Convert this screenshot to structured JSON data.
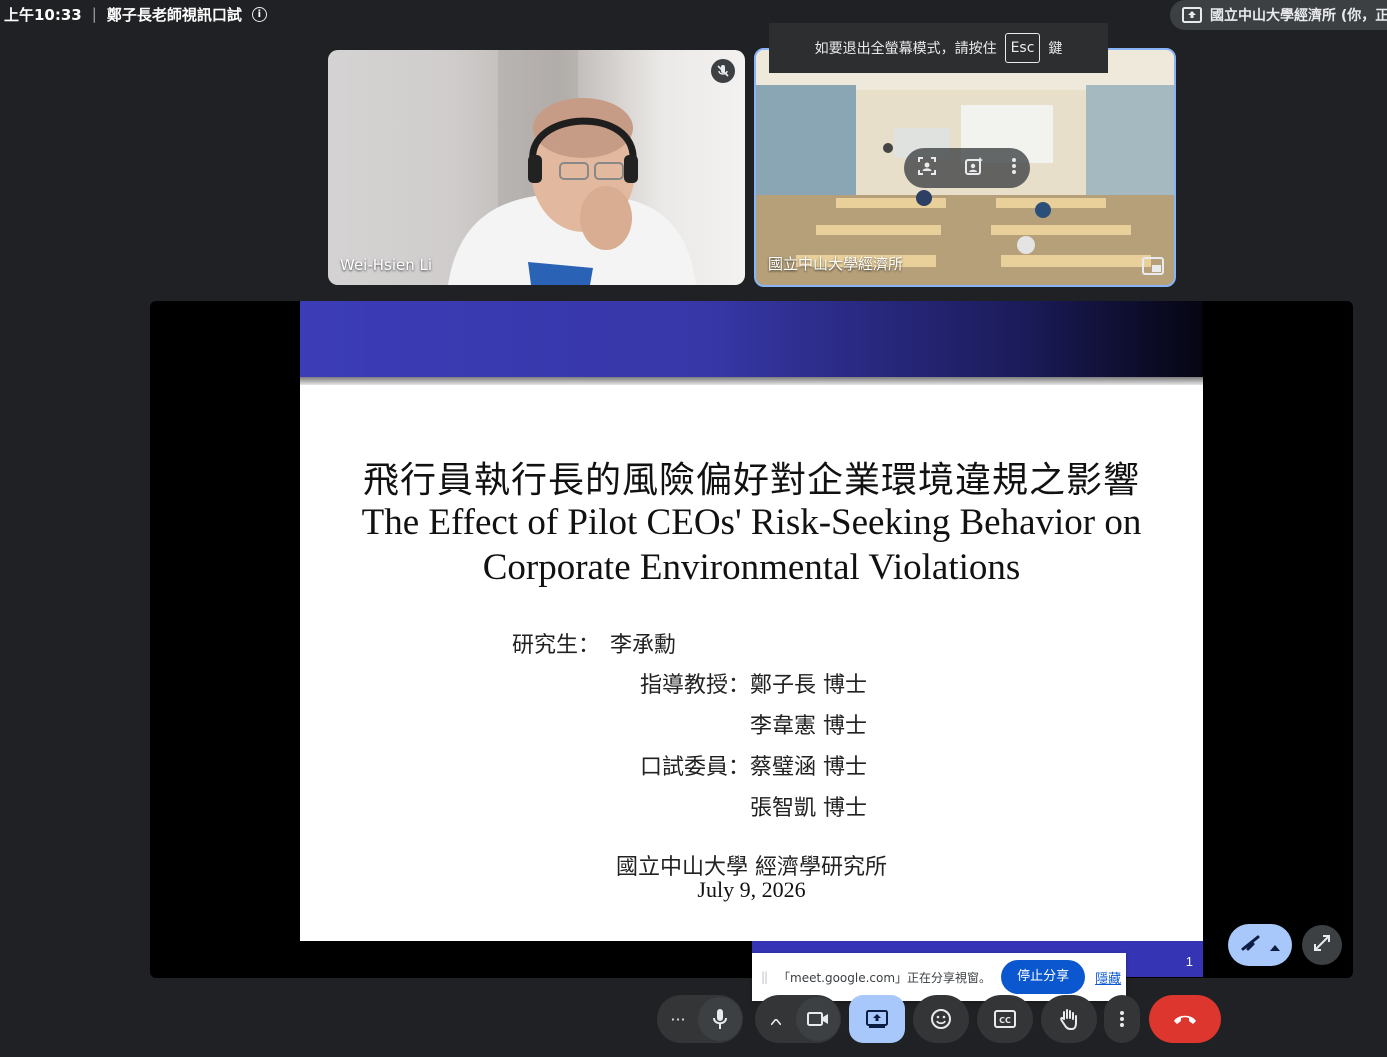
{
  "status": {
    "time": "上午10:33",
    "separator": "|",
    "meeting_title": "鄭子長老師視訊口試"
  },
  "presenter_chip": {
    "label": "國立中山大學經濟所 (你，正"
  },
  "fullscreen_toast": {
    "before": "如要退出全螢幕模式，請按住",
    "key": "Esc",
    "after": "鍵"
  },
  "participants": [
    {
      "name": "Wei-Hsien Li",
      "muted": true
    },
    {
      "name": "國立中山大學經濟所"
    }
  ],
  "slide": {
    "title_zh": "飛行員執行長的風險偏好對企業環境違規之影響",
    "title_en_line1": "The Effect of Pilot CEOs' Risk-Seeking Behavior on",
    "title_en_line2": "Corporate Environmental Violations",
    "rows": [
      {
        "label": "研究生：",
        "value": "李承勳"
      },
      {
        "label": "指導教授：",
        "value": "鄭子長 博士"
      },
      {
        "label": "",
        "value": "李韋憲 博士"
      },
      {
        "label": "口試委員：",
        "value": "蔡璧涵 博士"
      },
      {
        "label": "",
        "value": "張智凱 博士"
      }
    ],
    "affiliation": "國立中山大學 經濟學研究所",
    "date": "July 9, 2026",
    "page_number": "1"
  },
  "share_notice": {
    "text": "「meet.google.com」正在分享視窗。",
    "stop_label": "停止分享",
    "hide_label": "隱藏"
  },
  "colors": {
    "background": "#202124",
    "accent": "#a8c7fa",
    "leave": "#dc362e",
    "slide_banner": "#3b3cb7"
  }
}
